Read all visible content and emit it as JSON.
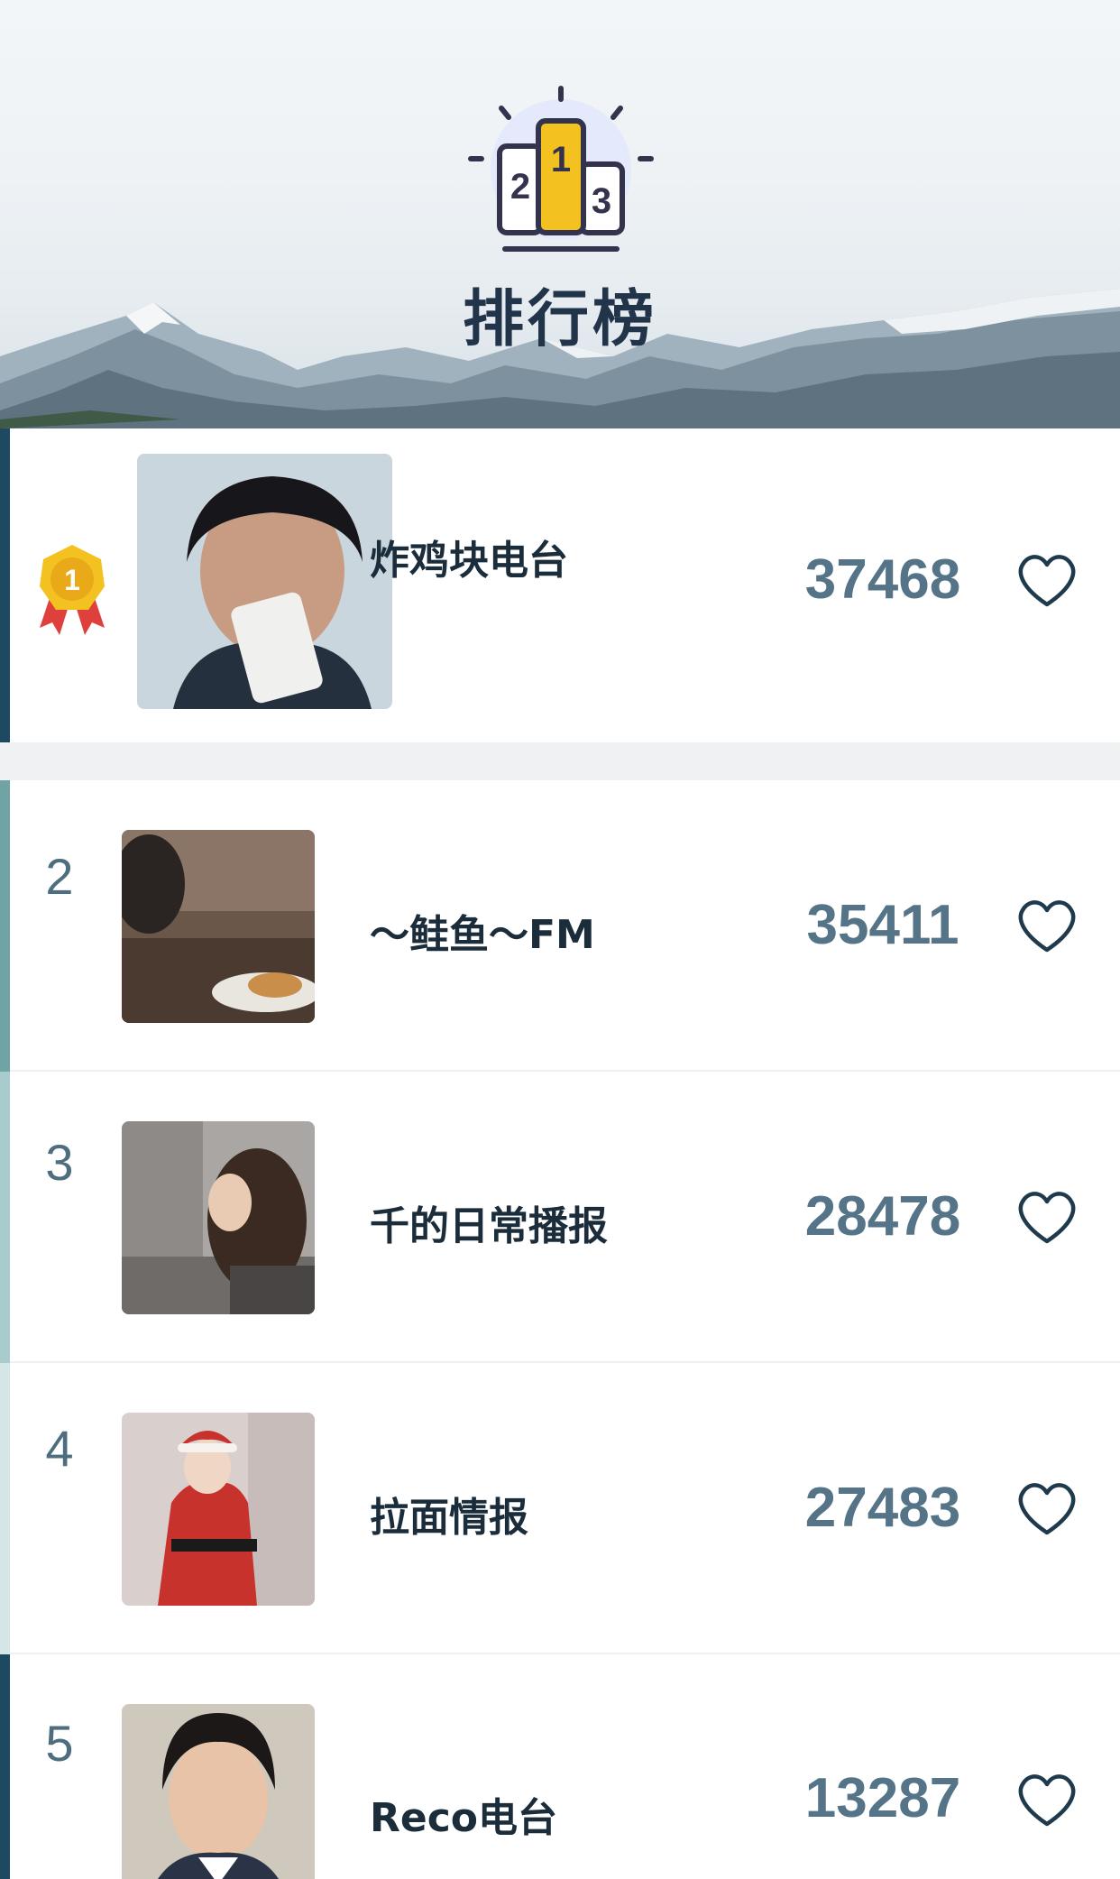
{
  "header": {
    "title": "排行榜",
    "podium_numbers": [
      "2",
      "1",
      "3"
    ]
  },
  "colors": {
    "accent_dark": "#1d4a60",
    "accent_teal": "#6fa3a4",
    "accent_light_teal": "#a8cccd",
    "accent_pale": "#d5e6e7",
    "gold": "#f3c221",
    "count_text": "#557488",
    "heart_stroke": "#1e3a4c"
  },
  "ranking": [
    {
      "rank": "1",
      "name": "炸鸡块电台",
      "count": "37468",
      "badge": "gold-medal-icon"
    },
    {
      "rank": "2",
      "name": "～鲑鱼～FM",
      "count": "35411"
    },
    {
      "rank": "3",
      "name": "千的日常播报",
      "count": "28478"
    },
    {
      "rank": "4",
      "name": "拉面情报",
      "count": "27483"
    },
    {
      "rank": "5",
      "name": "Reco电台",
      "count": "13287"
    }
  ],
  "icons": {
    "header": "podium-icon",
    "like": "heart-icon",
    "first_place": "gold-medal-icon"
  }
}
